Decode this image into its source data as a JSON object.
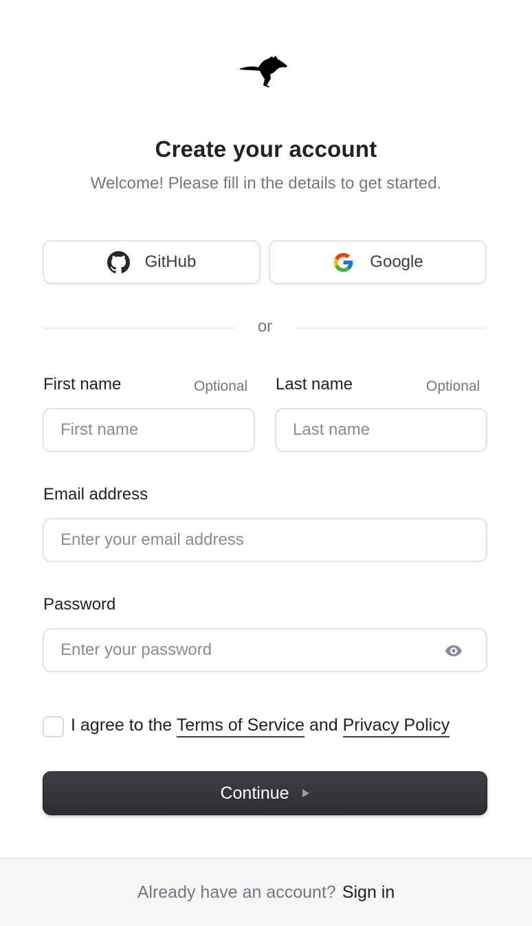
{
  "header": {
    "title": "Create your account",
    "subtitle": "Welcome! Please fill in the details to get started."
  },
  "social": {
    "github_label": "GitHub",
    "google_label": "Google"
  },
  "divider": {
    "text": "or"
  },
  "form": {
    "first_name": {
      "label": "First name",
      "optional": "Optional",
      "placeholder": "First name",
      "value": ""
    },
    "last_name": {
      "label": "Last name",
      "optional": "Optional",
      "placeholder": "Last name",
      "value": ""
    },
    "email": {
      "label": "Email address",
      "placeholder": "Enter your email address",
      "value": ""
    },
    "password": {
      "label": "Password",
      "placeholder": "Enter your password",
      "value": ""
    },
    "agree": {
      "prefix": "I agree to the",
      "terms": "Terms of Service",
      "and": "and",
      "privacy": "Privacy Policy",
      "checked": false
    },
    "continue_label": "Continue"
  },
  "footer": {
    "prompt": "Already have an account?",
    "link": "Sign in"
  },
  "colors": {
    "primary_button": "#2f3035",
    "muted_text": "#747686",
    "border": "#e3e3e6"
  },
  "icons": {
    "logo": "kangaroo-logo-icon",
    "github": "github-icon",
    "google": "google-icon",
    "eye": "eye-icon",
    "continue": "triangle-right-icon"
  }
}
